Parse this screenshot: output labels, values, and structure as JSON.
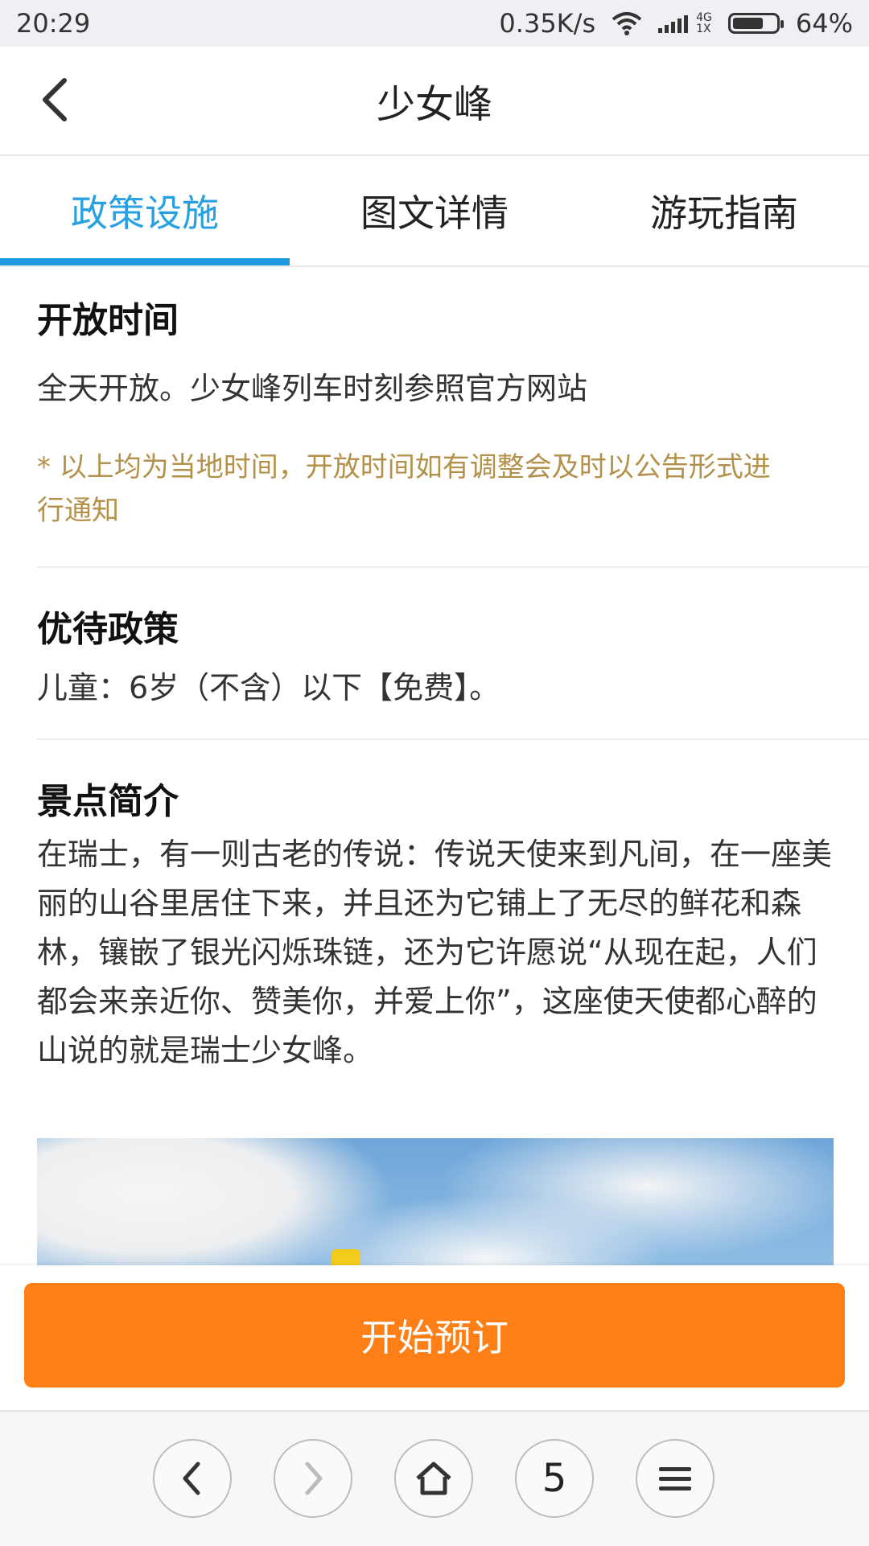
{
  "status_bar": {
    "time": "20:29",
    "network_speed": "0.35K/s",
    "network_type_top": "4G",
    "network_type_bottom": "1X",
    "battery_percent": "64%",
    "battery_level": 0.64
  },
  "header": {
    "title": "少女峰",
    "back_icon": "chevron-left-icon"
  },
  "tabs": [
    {
      "label": "政策设施",
      "active": true
    },
    {
      "label": "图文详情",
      "active": false
    },
    {
      "label": "游玩指南",
      "active": false
    }
  ],
  "sections": {
    "open_time": {
      "title": "开放时间",
      "text": "全天开放。少女峰列车时刻参照官方网站",
      "note": "* 以上均为当地时间，开放时间如有调整会及时以公告形式进行通知"
    },
    "policy": {
      "title": "优待政策",
      "text": "儿童：6岁（不含）以下【免费】。"
    },
    "intro": {
      "title": "景点简介",
      "text": "在瑞士，有一则古老的传说：传说天使来到凡间，在一座美丽的山谷里居住下来，并且还为它铺上了无尽的鲜花和森林，镶嵌了银光闪烁珠链，还为它许愿说“从现在起，人们都会来亲近你、赞美你，并爱上你”，这座使天使都心醉的山说的就是瑞士少女峰。"
    }
  },
  "booking": {
    "button_label": "开始预订",
    "button_color": "#ff7f17"
  },
  "browser_nav": {
    "tab_count": "5"
  },
  "colors": {
    "accent": "#27a1e2",
    "note": "#b3914a"
  }
}
